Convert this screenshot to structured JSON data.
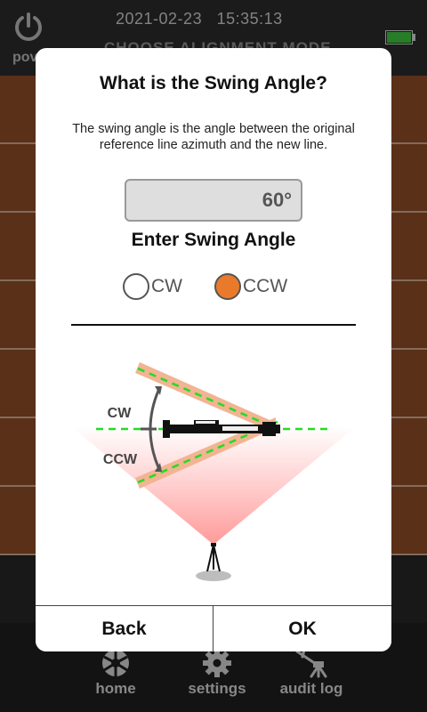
{
  "status": {
    "date": "2021-02-23",
    "time": "15:35:13",
    "battery_level": 1.0,
    "battery_color": "#3ec23e"
  },
  "topbar": {
    "power_label": "pov",
    "screen_title": "CHOOSE ALIGNMENT MODE",
    "power_icon": "power-icon"
  },
  "nav": {
    "items": [
      {
        "label": "home",
        "icon": "home-icon"
      },
      {
        "label": "settings",
        "icon": "gear-icon"
      },
      {
        "label": "audit log",
        "icon": "survey-instrument-icon"
      }
    ]
  },
  "dialog": {
    "title": "What is the Swing Angle?",
    "description": "The swing angle is the angle between the original reference line azimuth and the new line.",
    "angle_value": "60°",
    "enter_label": "Enter Swing Angle",
    "options": [
      {
        "label": "CW",
        "selected": false
      },
      {
        "label": "CCW",
        "selected": true
      }
    ],
    "diagram": {
      "cw_label": "CW",
      "ccw_label": "CCW"
    },
    "back_label": "Back",
    "ok_label": "OK"
  },
  "colors": {
    "accent": "#ea7a2b",
    "row_brown": "#8b4a25",
    "guide_green": "#22dd22",
    "beam_band": "#f2b493"
  }
}
